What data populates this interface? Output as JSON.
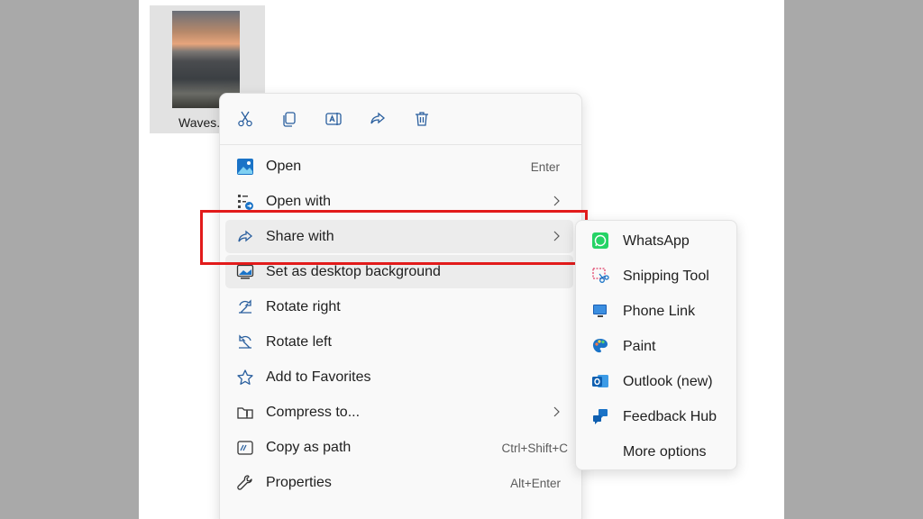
{
  "file": {
    "name": "Waves."
  },
  "quick_actions": [
    {
      "name": "cut",
      "icon": "scissors-icon"
    },
    {
      "name": "copy",
      "icon": "copy-icon"
    },
    {
      "name": "rename",
      "icon": "rename-icon"
    },
    {
      "name": "share",
      "icon": "share-icon"
    },
    {
      "name": "delete",
      "icon": "trash-icon"
    }
  ],
  "menu": {
    "items": [
      {
        "label": "Open",
        "shortcut": "Enter",
        "icon": "photos-icon"
      },
      {
        "label": "Open with",
        "icon": "open-with-icon"
      },
      {
        "label": "Share with",
        "icon": "share-icon"
      },
      {
        "label": "Set as desktop background",
        "icon": "desktop-background-icon"
      },
      {
        "label": "Rotate right",
        "icon": "rotate-right-icon"
      },
      {
        "label": "Rotate left",
        "icon": "rotate-left-icon"
      },
      {
        "label": "Add to Favorites",
        "icon": "star-icon"
      },
      {
        "label": "Compress to...",
        "icon": "zip-folder-icon"
      },
      {
        "label": "Copy as path",
        "shortcut": "Ctrl+Shift+C",
        "icon": "copy-path-icon"
      },
      {
        "label": "Properties",
        "shortcut": "Alt+Enter",
        "icon": "wrench-icon"
      }
    ]
  },
  "share_submenu": {
    "items": [
      {
        "label": "WhatsApp",
        "icon": "whatsapp-icon"
      },
      {
        "label": "Snipping Tool",
        "icon": "snipping-tool-icon"
      },
      {
        "label": "Phone Link",
        "icon": "phone-link-icon"
      },
      {
        "label": "Paint",
        "icon": "paint-icon"
      },
      {
        "label": "Outlook (new)",
        "icon": "outlook-icon"
      },
      {
        "label": "Feedback Hub",
        "icon": "feedback-hub-icon"
      },
      {
        "label": "More options",
        "icon": ""
      }
    ]
  },
  "colors": {
    "highlight_border": "#e21b1b",
    "menu_bg": "#f9f9f9",
    "accent": "#1a73c7"
  }
}
